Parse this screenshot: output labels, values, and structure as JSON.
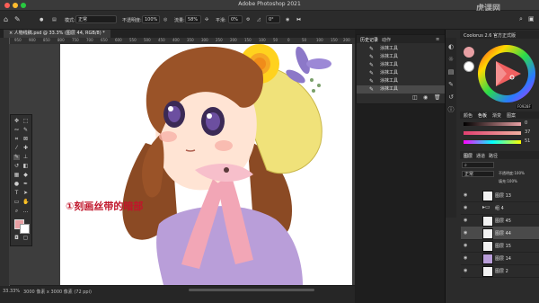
{
  "app": {
    "title": "Adobe Photoshop 2021",
    "watermark": "虎课网"
  },
  "options_bar": {
    "mode_label": "模式:",
    "mode_value": "正常",
    "opacity_label": "不透明度:",
    "opacity_value": "100%",
    "flow_label": "流量:",
    "flow_value": "58%",
    "smooth_label": "平滑:",
    "smooth_value": "0%",
    "angle_value": "0°"
  },
  "document": {
    "tab_title": "人物线稿.psd @ 33.3% (图层 44, RGB/8) *"
  },
  "ruler": {
    "ticks": [
      "950",
      "900",
      "850",
      "800",
      "750",
      "700",
      "650",
      "600",
      "550",
      "500",
      "450",
      "400",
      "350",
      "300",
      "250",
      "200",
      "150",
      "100",
      "50",
      "0",
      "50",
      "100",
      "150",
      "200"
    ]
  },
  "canvas": {
    "annotation": "①刻画丝带的暗部"
  },
  "status": {
    "zoom": "33.33%",
    "doc_info": "3000 像素 x 3000 像素 (72 ppi)"
  },
  "history": {
    "tabs": [
      "历史记录",
      "动作"
    ],
    "items": [
      "涂抹工具",
      "涂抹工具",
      "涂抹工具",
      "涂抹工具",
      "涂抹工具",
      "涂抹工具"
    ]
  },
  "color_panel": {
    "title": "Coolorus 2.6 官方正式版",
    "hex": "F0928F"
  },
  "swatches": {
    "tabs": [
      "颜色",
      "色板",
      "渐变",
      "图案"
    ]
  },
  "sliders": {
    "values": [
      "0",
      "37",
      "51"
    ]
  },
  "layers": {
    "tabs": [
      "图层",
      "通道",
      "路径"
    ],
    "blend": "正常",
    "opacity_label": "不透明度:",
    "opacity_value": "100%",
    "fill_label": "填充:",
    "fill_value": "100%",
    "items": [
      "图层 13",
      "组 4",
      "图层 45",
      "图层 44",
      "图层 15",
      "图层 14",
      "图层 2"
    ]
  },
  "colors": {
    "accent": "#2d6ad8",
    "brush_fg": "#e8a0a4",
    "annotation": "#c0152a"
  }
}
